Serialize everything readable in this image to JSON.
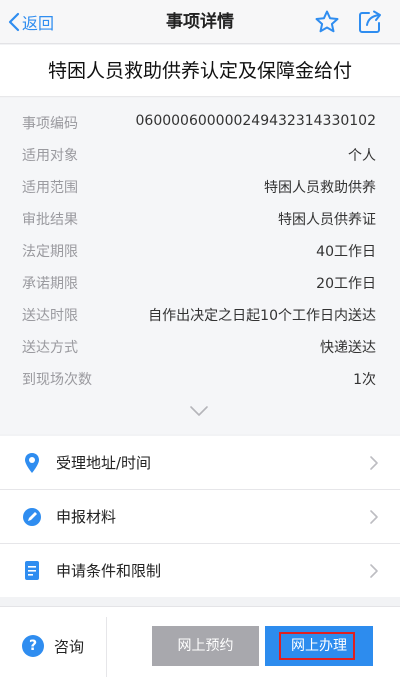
{
  "nav": {
    "back_label": "返回",
    "title": "事项详情",
    "star_icon": "star-icon",
    "share_icon": "share-icon"
  },
  "main_title": "特困人员救助供养认定及保障金给付",
  "details": [
    {
      "key": "事项编码",
      "value": "0600006000002494323143301​02"
    },
    {
      "key": "适用对象",
      "value": "个人"
    },
    {
      "key": "适用范围",
      "value": "特困人员救助供养"
    },
    {
      "key": "审批结果",
      "value": "特困人员供养证"
    },
    {
      "key": "法定期限",
      "value": "40工作日"
    },
    {
      "key": "承诺期限",
      "value": "20工作日"
    },
    {
      "key": "送达时限",
      "value": "自作出决定之日起10个工作日内送达"
    },
    {
      "key": "送达方式",
      "value": "快递送达"
    },
    {
      "key": "到现场次数",
      "value": "1次"
    }
  ],
  "list": [
    {
      "label": "受理地址/时间",
      "icon": "location-pin-icon"
    },
    {
      "label": "申报材料",
      "icon": "pen-icon"
    },
    {
      "label": "申请条件和限制",
      "icon": "document-icon"
    }
  ],
  "bottom": {
    "consult_label": "咨询",
    "consult_icon_text": "?",
    "reserve_label": "网上预约",
    "online_label": "网上办理"
  },
  "colors": {
    "accent": "#2d8cee",
    "highlight_border": "#e02020",
    "reserve_bg": "#a8a8ad"
  }
}
